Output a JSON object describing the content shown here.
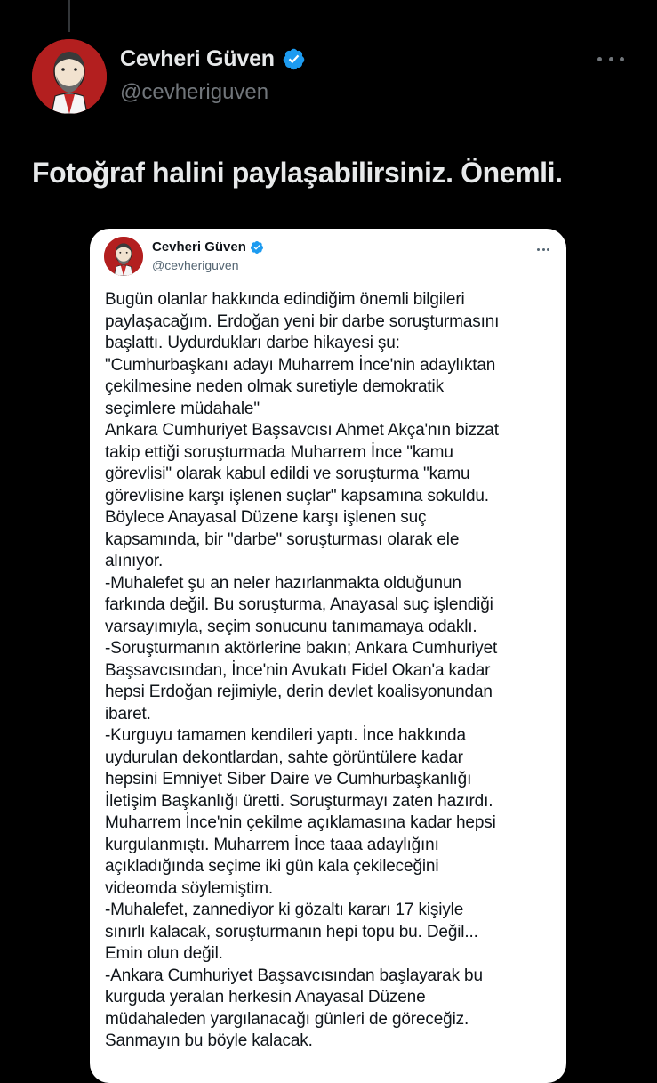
{
  "author": {
    "name": "Cevheri Güven",
    "handle": "@cevheriguven",
    "avatar_icon": "caricature-avatar-icon",
    "verified_icon": "verified-badge-icon",
    "verified_color": "#1d9bf0"
  },
  "tweet": {
    "text": "Fotoğraf halini paylaşabilirsiniz. Önemli."
  },
  "embedded_screenshot": {
    "author_name": "Cevheri Güven",
    "author_handle": "@cevheriguven",
    "lines": [
      "Bugün olanlar hakkında edindiğim önemli bilgileri",
      "paylaşacağım. Erdoğan yeni bir darbe soruşturmasını",
      "başlattı. Uydurdukları darbe hikayesi şu:",
      "\"Cumhurbaşkanı adayı Muharrem İnce'nin adaylıktan",
      "çekilmesine neden olmak suretiyle demokratik",
      "seçimlere müdahale\"",
      "Ankara Cumhuriyet Başsavcısı Ahmet Akça'nın bizzat",
      "takip ettiği soruşturmada Muharrem İnce \"kamu",
      "görevlisi\" olarak kabul edildi ve soruşturma \"kamu",
      "görevlisine karşı işlenen suçlar\" kapsamına sokuldu.",
      "Böylece Anayasal Düzene karşı işlenen suç",
      "kapsamında, bir \"darbe\" soruşturması olarak ele",
      "alınıyor.",
      "-Muhalefet şu an neler hazırlanmakta olduğunun",
      "farkında değil. Bu soruşturma, Anayasal suç işlendiği",
      "varsayımıyla, seçim sonucunu tanımamaya odaklı.",
      "-Soruşturmanın aktörlerine bakın; Ankara Cumhuriyet",
      "Başsavcısından, İnce'nin Avukatı Fidel Okan'a kadar",
      "hepsi Erdoğan rejimiyle, derin devlet koalisyonundan",
      "ibaret.",
      "-Kurguyu tamamen kendileri yaptı. İnce hakkında",
      "uydurulan dekontlardan, sahte görüntülere kadar",
      "hepsini Emniyet Siber Daire ve Cumhurbaşkanlığı",
      "İletişim Başkanlığı üretti. Soruşturmayı zaten hazırdı.",
      "Muharrem İnce'nin çekilme açıklamasına kadar hepsi",
      "kurgulanmıştı. Muharrem İnce taaa adaylığını",
      "açıkladığında seçime iki gün kala çekileceğini",
      "videomda söylemiştim.",
      "-Muhalefet, zannediyor ki gözaltı kararı 17 kişiyle",
      "sınırlı kalacak, soruşturmanın hepi topu bu. Değil...",
      "Emin olun değil.",
      "-Ankara Cumhuriyet Başsavcısından başlayarak bu",
      "kurguda yeralan herkesin Anayasal Düzene",
      "müdahaleden yargılanacağı günleri de göreceğiz.",
      "Sanmayın bu böyle kalacak."
    ]
  },
  "colors": {
    "background": "#000000",
    "text_primary": "#e7e9ea",
    "text_secondary": "#71767b",
    "card_background": "#ffffff",
    "card_text": "#0f1419",
    "card_secondary": "#536471",
    "avatar_bg": "#b31f1f"
  }
}
